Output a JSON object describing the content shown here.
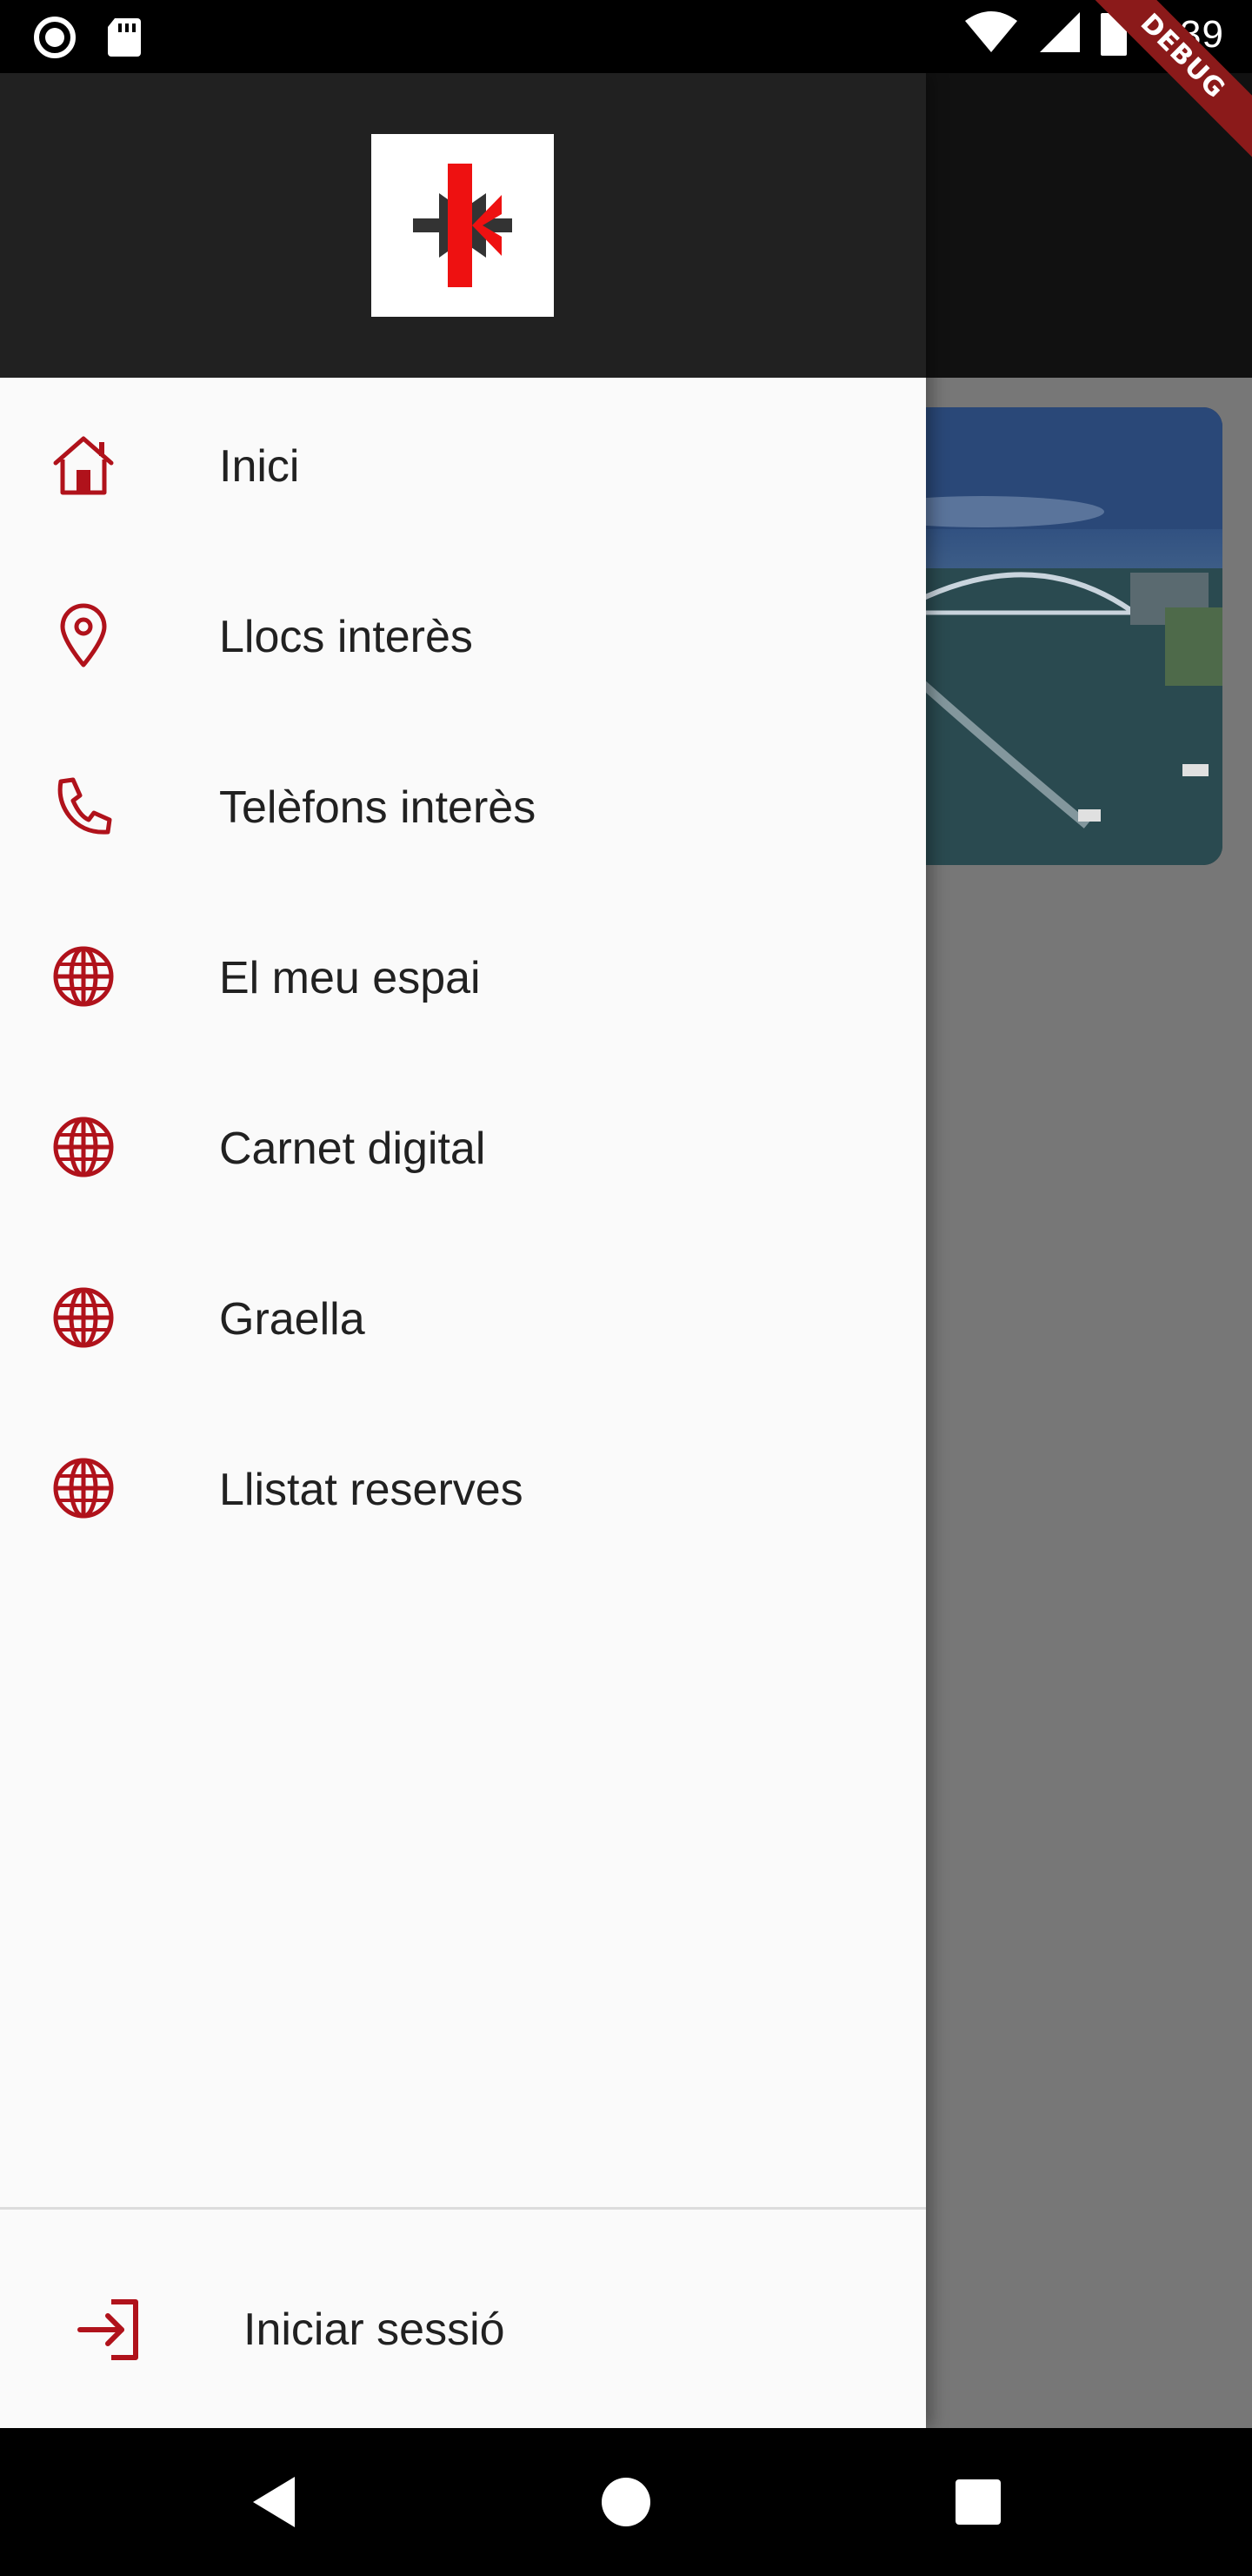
{
  "status_bar": {
    "time": "1:39",
    "left_icons": [
      "record-indicator-icon",
      "sd-card-icon"
    ],
    "right_icons": [
      "wifi-icon",
      "cell-signal-icon",
      "battery-icon"
    ]
  },
  "debug_banner": "DEBUG",
  "drawer": {
    "header_logo": "app-logo",
    "items": [
      {
        "label": "Inici",
        "icon": "home-icon"
      },
      {
        "label": "Llocs interès",
        "icon": "location-pin-icon"
      },
      {
        "label": "Telèfons interès",
        "icon": "phone-icon"
      },
      {
        "label": "El meu espai",
        "icon": "globe-icon"
      },
      {
        "label": "Carnet digital",
        "icon": "globe-icon"
      },
      {
        "label": "Graella",
        "icon": "globe-icon"
      },
      {
        "label": "Llistat reserves",
        "icon": "globe-icon"
      }
    ],
    "footer": {
      "label": "Iniciar sessió",
      "icon": "login-icon"
    }
  },
  "colors": {
    "accent": "#b0121b",
    "drawer_bg": "#fafafa",
    "header_bg": "#212121",
    "scrim": "#777777"
  },
  "nav_bar": [
    "back-button",
    "home-button",
    "recents-button"
  ]
}
